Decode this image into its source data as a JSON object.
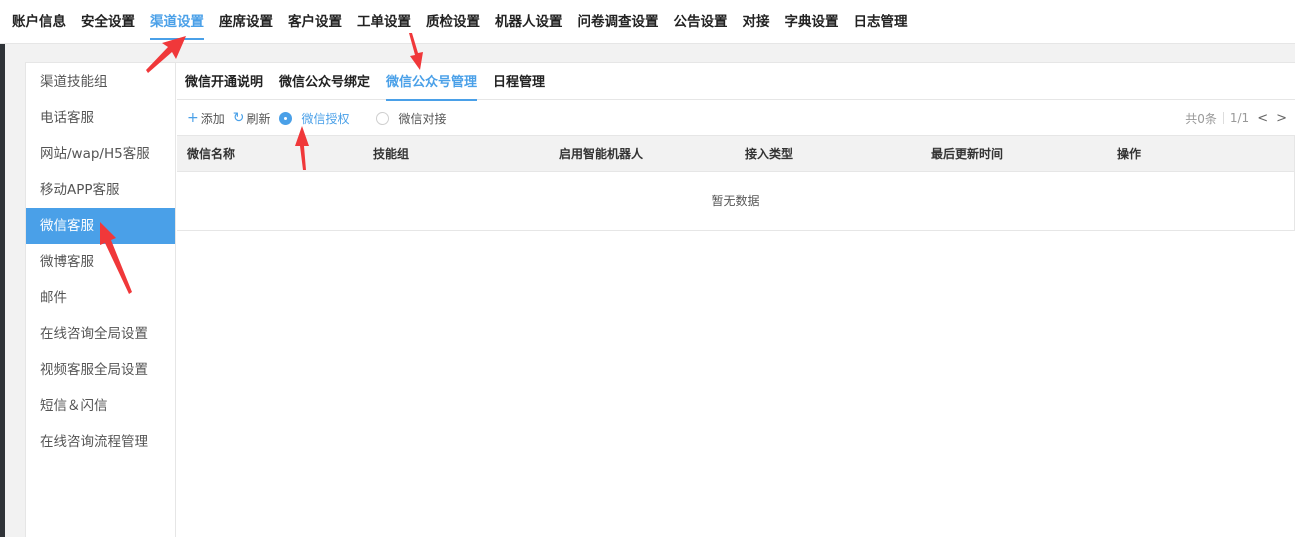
{
  "topnav": {
    "items": [
      {
        "label": "账户信息"
      },
      {
        "label": "安全设置"
      },
      {
        "label": "渠道设置",
        "active": true
      },
      {
        "label": "座席设置"
      },
      {
        "label": "客户设置"
      },
      {
        "label": "工单设置"
      },
      {
        "label": "质检设置"
      },
      {
        "label": "机器人设置"
      },
      {
        "label": "问卷调查设置"
      },
      {
        "label": "公告设置"
      },
      {
        "label": "对接"
      },
      {
        "label": "字典设置"
      },
      {
        "label": "日志管理"
      }
    ]
  },
  "sidebar": {
    "items": [
      {
        "label": "渠道技能组"
      },
      {
        "label": "电话客服"
      },
      {
        "label": "网站/wap/H5客服"
      },
      {
        "label": "移动APP客服"
      },
      {
        "label": "微信客服",
        "active": true
      },
      {
        "label": "微博客服"
      },
      {
        "label": "邮件"
      },
      {
        "label": "在线咨询全局设置"
      },
      {
        "label": "视频客服全局设置"
      },
      {
        "label": "短信＆闪信"
      },
      {
        "label": "在线咨询流程管理"
      }
    ]
  },
  "subtabs": {
    "items": [
      {
        "label": "微信开通说明"
      },
      {
        "label": "微信公众号绑定"
      },
      {
        "label": "微信公众号管理",
        "active": true
      },
      {
        "label": "日程管理"
      }
    ]
  },
  "toolbar": {
    "add_label": "添加",
    "refresh_label": "刷新",
    "radios": [
      {
        "label": "微信授权",
        "checked": true
      },
      {
        "label": "微信对接",
        "checked": false
      }
    ]
  },
  "pager": {
    "total": "共0条",
    "page": "1/1",
    "prev": "<",
    "next": ">"
  },
  "table": {
    "columns": [
      "微信名称",
      "技能组",
      "启用智能机器人",
      "接入类型",
      "最后更新时间",
      "操作"
    ],
    "empty_text": "暂无数据"
  },
  "colors": {
    "accent": "#4aa0e8",
    "annotation_arrow": "#f0383a"
  }
}
